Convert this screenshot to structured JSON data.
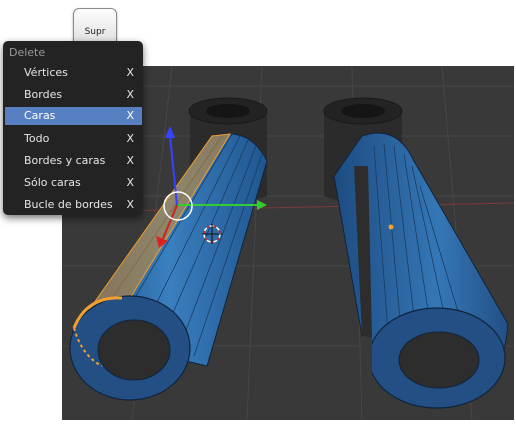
{
  "key": {
    "label": "Supr"
  },
  "menu": {
    "title": "Delete",
    "items": [
      {
        "label": "Vértices",
        "shortcut": "X"
      },
      {
        "label": "Bordes",
        "shortcut": "X"
      },
      {
        "label": "Caras",
        "shortcut": "X"
      },
      {
        "label": "Todo",
        "shortcut": "X"
      },
      {
        "label": "Bordes y caras",
        "shortcut": "X"
      },
      {
        "label": "Sólo caras",
        "shortcut": "X"
      },
      {
        "label": "Bucle de bordes",
        "shortcut": "X"
      }
    ],
    "selected_index": 2
  },
  "colors": {
    "viewport_bg": "#393939",
    "menu_bg": "#232323",
    "highlight": "#5680c2",
    "mesh": "#2f6aa4",
    "selection": "#f0a030"
  }
}
